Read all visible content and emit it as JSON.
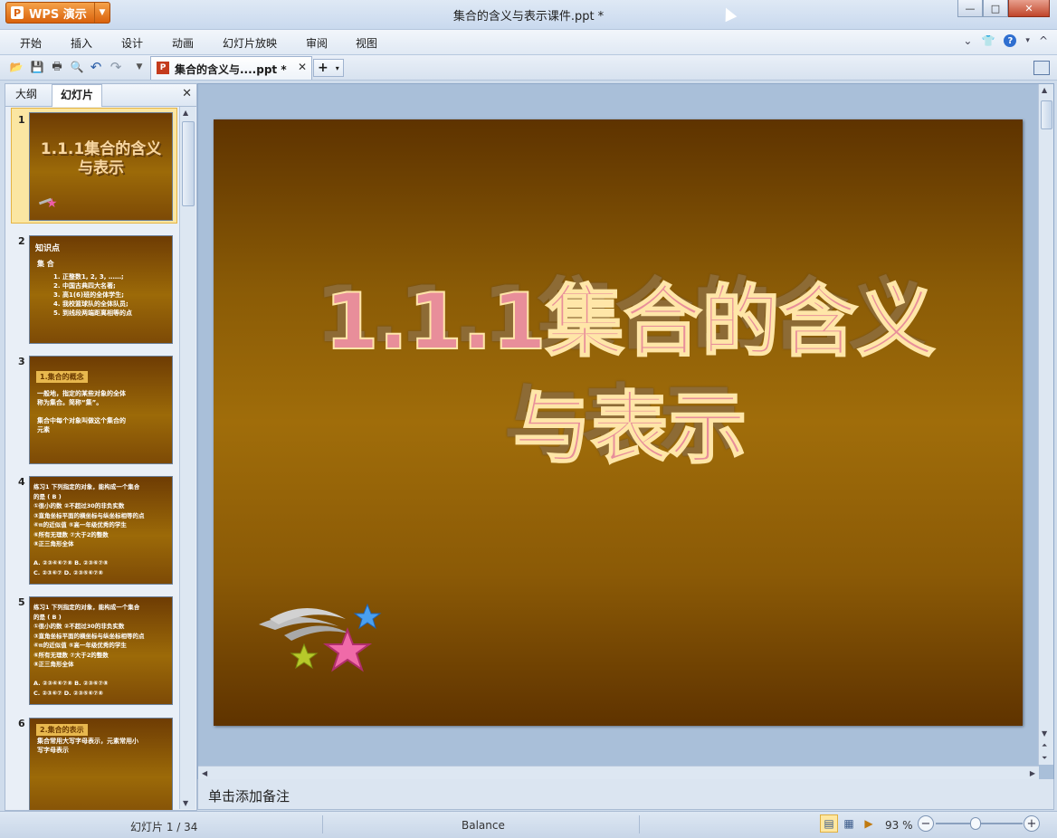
{
  "app": {
    "name": "WPS 演示",
    "window_title": "集合的含义与表示课件.ppt *"
  },
  "menu": {
    "items": [
      "开始",
      "插入",
      "设计",
      "动画",
      "幻灯片放映",
      "审阅",
      "视图"
    ]
  },
  "toolbar": {
    "doc_tab_label": "集合的含义与....ppt *",
    "new_tab_label": "+"
  },
  "left_panel": {
    "tabs": [
      "大纲",
      "幻灯片"
    ],
    "active_tab": "幻灯片",
    "slides": [
      {
        "num": "1",
        "title": "1.1.1集合的含义\n与表示"
      },
      {
        "num": "2",
        "head": "知识点",
        "sub": "集 合",
        "body": "1. 正整数1, 2, 3, ……;\n2. 中国古典四大名著;\n3. 高1(6)班的全体学生;\n4. 我校篮球队的全体队员;\n5. 到线段两端距离相等的点"
      },
      {
        "num": "3",
        "tag": "1.集合的概念",
        "body": "    一般地，指定的某些对象的全体\n称为集合。简称“集”。\n\n    集合中每个对象叫做这个集合的\n元素"
      },
      {
        "num": "4",
        "body": "练习1 下列指定的对象，能构成一个集合\n的是                        ( B )\n①很小的数        ②不超过30的非负实数\n③直角坐标平面的横坐标与纵坐标相等的点\n④π的近似值      ⑤高一年级优秀的学生\n⑥所有无理数      ⑦大于2的整数\n⑧正三角形全体\n\nA. ②③④⑥⑦⑧       B. ②③⑥⑦⑧\nC. ②③⑥⑦           D. ②③⑤⑥⑦⑧"
      },
      {
        "num": "5",
        "body": "练习1 下列指定的对象，能构成一个集合\n的是                        ( B )\n①很小的数        ②不超过30的非负实数\n③直角坐标平面的横坐标与纵坐标相等的点\n④π的近似值      ⑤高一年级优秀的学生\n⑥所有无理数      ⑦大于2的整数\n⑧正三角形全体\n\nA. ②③④⑥⑦⑧       B. ②③⑥⑦⑧\nC. ②③⑥⑦           D. ②③⑤⑥⑦⑧"
      },
      {
        "num": "6",
        "tag": "2.集合的表示",
        "body": "    集合常用大写字母表示，元素常用小\n写字母表示"
      }
    ]
  },
  "slide": {
    "title_line1": "1.1.1集合的含义",
    "title_line2": "与表示"
  },
  "notes": {
    "placeholder": "单击添加备注"
  },
  "status": {
    "slide_indicator": "幻灯片 1 / 34",
    "theme": "Balance",
    "zoom": "93 %",
    "zoom_fraction": 0.45
  },
  "colors": {
    "slide_bg_dark": "#5e3300",
    "slide_bg_mid": "#a06d0a",
    "title_fill": "#e88e9a",
    "title_outline": "#ffe6a8",
    "accent_orange": "#d9620c"
  }
}
